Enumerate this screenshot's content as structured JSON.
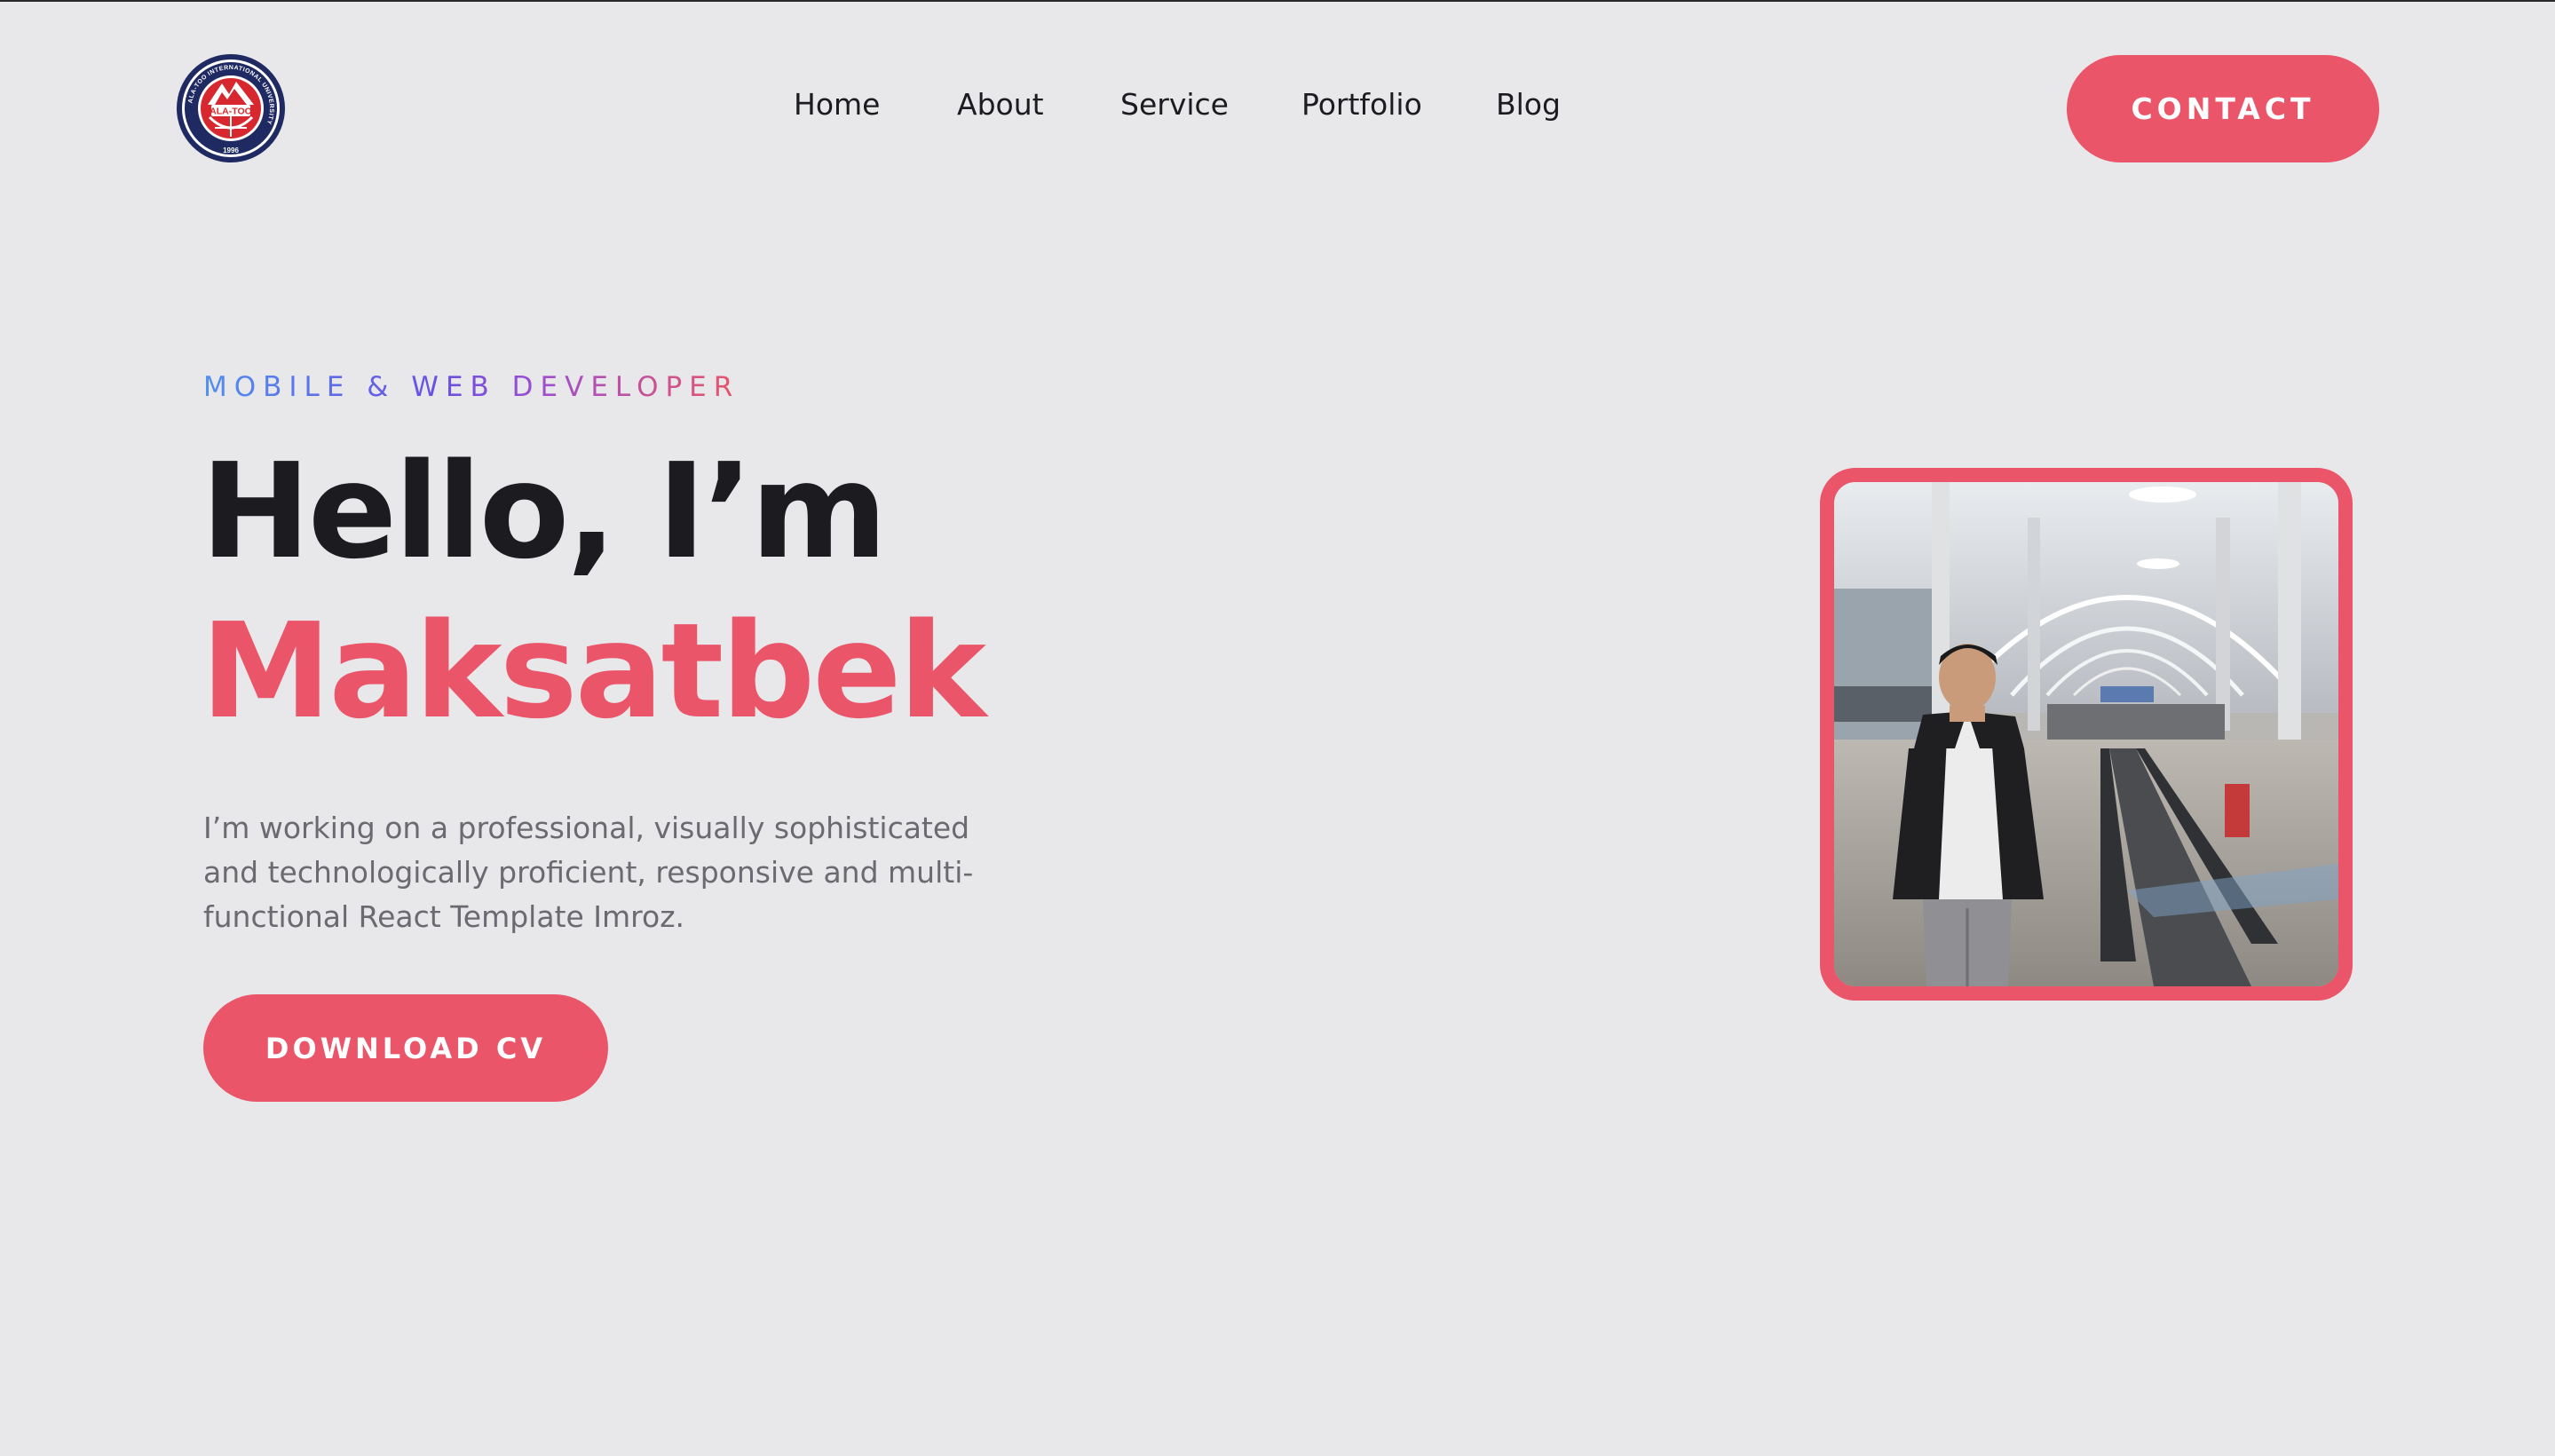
{
  "header": {
    "logo": {
      "icon": "university-seal-icon",
      "label": "ALA-TOO",
      "ring_text": "ALA-TOO INTERNATIONAL UNIVERSITY",
      "year": "1996"
    },
    "nav": [
      {
        "label": "Home"
      },
      {
        "label": "About"
      },
      {
        "label": "Service"
      },
      {
        "label": "Portfolio"
      },
      {
        "label": "Blog"
      }
    ],
    "contact_label": "CONTACT"
  },
  "hero": {
    "tagline": "MOBILE & WEB DEVELOPER",
    "greeting": "Hello, I’m",
    "name": "Maksatbek",
    "description": "I’m working on a professional, visually sophisticated and technologically proficient, responsive and multi-functional React Template Imroz.",
    "download_label": "DOWNLOAD CV",
    "photo": {
      "icon": "profile-photo"
    }
  },
  "colors": {
    "accent": "#ea5569",
    "background": "#e8e8ea",
    "text_dark": "#1b1b20",
    "text_muted": "#6a6a70",
    "gradient": [
      "#4f8ff0",
      "#6b4fe0",
      "#9b4fd0",
      "#ea5569"
    ]
  }
}
